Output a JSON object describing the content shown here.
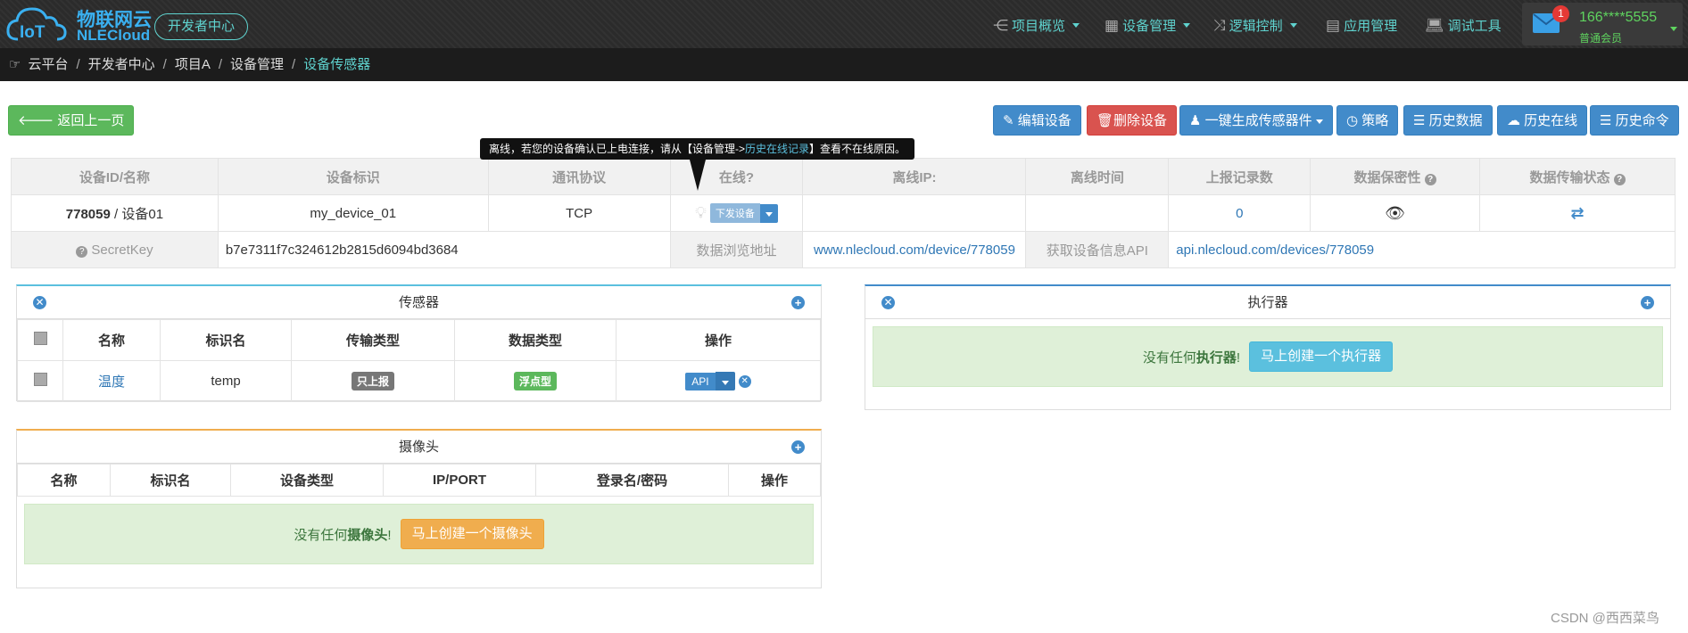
{
  "brand": {
    "name_cn": "物联网云",
    "name_en": "NLECloud",
    "dev_center": "开发者中心"
  },
  "nav": [
    {
      "label": "项目概览",
      "icon": "share-icon",
      "dropdown": true
    },
    {
      "label": "设备管理",
      "icon": "grid-icon",
      "dropdown": true
    },
    {
      "label": "逻辑控制",
      "icon": "shuffle-icon",
      "dropdown": true
    },
    {
      "label": "应用管理",
      "icon": "app-icon",
      "dropdown": false
    },
    {
      "label": "调试工具",
      "icon": "laptop-icon",
      "dropdown": false
    }
  ],
  "user": {
    "badge": "1",
    "name": "166****5555",
    "role": "普通会员"
  },
  "breadcrumb": [
    "云平台",
    "开发者中心",
    "项目A",
    "设备管理",
    "设备传感器"
  ],
  "toolbar": {
    "back": "返回上一页",
    "edit": "编辑设备",
    "delete": "删除设备",
    "gen": "一键生成传感器件",
    "strategy": "策略",
    "history_data": "历史数据",
    "history_online": "历史在线",
    "history_cmd": "历史命令"
  },
  "tooltip": {
    "pre": "离线，若您的设备确认已上电连接，请从【设备管理->",
    "link": "历史在线记录",
    "post": "】查看不在线原因。"
  },
  "device": {
    "headers": [
      "设备ID/名称",
      "设备标识",
      "通讯协议",
      "在线?",
      "离线IP:",
      "离线时间",
      "上报记录数",
      "数据保密性",
      "数据传输状态"
    ],
    "id": "778059",
    "name": " / 设备01",
    "tag": "my_device_01",
    "protocol": "TCP",
    "send_btn": "下发设备",
    "offline_ip": "",
    "offline_time": "",
    "record_count": "0",
    "secret_label": "SecretKey",
    "secret_value": "b7e7311f7c324612b2815d6094bd3684",
    "browse_label": "数据浏览地址",
    "browse_url": "www.nlecloud.com/device/778059",
    "api_label": "获取设备信息API",
    "api_url": "api.nlecloud.com/devices/778059"
  },
  "sensors": {
    "title": "传感器",
    "headers": [
      "名称",
      "标识名",
      "传输类型",
      "数据类型",
      "操作"
    ],
    "rows": [
      {
        "name": "温度",
        "tag": "temp",
        "trans": "只上报",
        "dtype": "浮点型",
        "op": "API"
      }
    ]
  },
  "actuators": {
    "title": "执行器",
    "empty_pre": "没有任何",
    "empty_bold": "执行器",
    "empty_post": "!",
    "create": "马上创建一个执行器"
  },
  "cameras": {
    "title": "摄像头",
    "headers": [
      "名称",
      "标识名",
      "设备类型",
      "IP/PORT",
      "登录名/密码",
      "操作"
    ],
    "empty_pre": "没有任何",
    "empty_bold": "摄像头",
    "empty_post": "!",
    "create": "马上创建一个摄像头"
  },
  "watermark": "CSDN @西西菜鸟"
}
